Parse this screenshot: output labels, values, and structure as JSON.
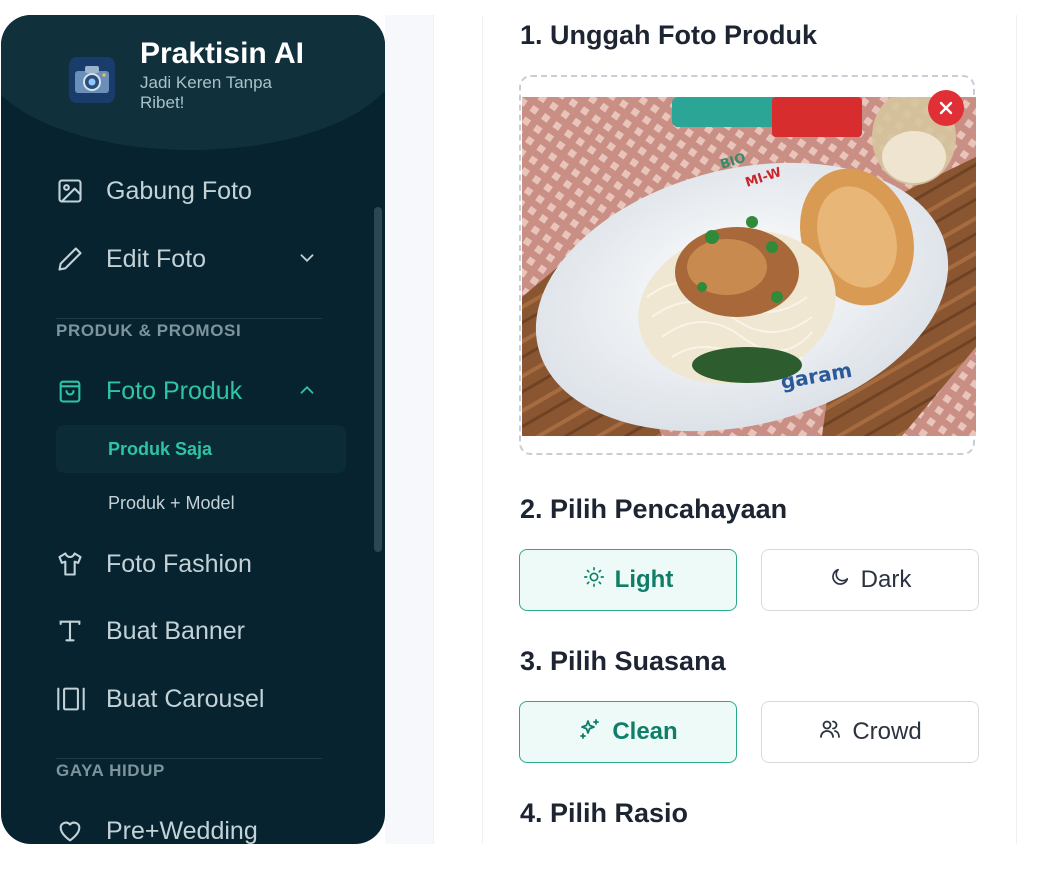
{
  "app": {
    "title": "Praktisin AI",
    "subtitle": "Jadi Keren Tanpa Ribet!"
  },
  "sidebar": {
    "items_top": [
      {
        "label": "Gabung Foto",
        "icon": "image-icon"
      },
      {
        "label": "Edit Foto",
        "icon": "pencil-icon",
        "chevron": "down"
      }
    ],
    "section_product": "PRODUK & PROMOSI",
    "foto_produk": {
      "label": "Foto Produk",
      "icon": "shopping-bag-icon",
      "chevron": "up"
    },
    "sub_items": [
      {
        "label": "Produk Saja",
        "active": true
      },
      {
        "label": "Produk + Model",
        "active": false
      }
    ],
    "items_mid": [
      {
        "label": "Foto Fashion",
        "icon": "shirt-icon"
      },
      {
        "label": "Buat Banner",
        "icon": "text-icon"
      },
      {
        "label": "Buat Carousel",
        "icon": "carousel-icon"
      }
    ],
    "section_life": "GAYA HIDUP",
    "items_bottom": [
      {
        "label": "Pre+Wedding",
        "icon": "heart-icon"
      }
    ]
  },
  "main": {
    "step1": "1. Unggah Foto Produk",
    "step2": "2. Pilih Pencahayaan",
    "lighting": [
      {
        "label": "Light",
        "icon": "sun-icon",
        "selected": true
      },
      {
        "label": "Dark",
        "icon": "moon-icon",
        "selected": false
      }
    ],
    "step3": "3. Pilih Suasana",
    "mood": [
      {
        "label": "Clean",
        "icon": "sparkles-icon",
        "selected": true
      },
      {
        "label": "Crowd",
        "icon": "users-icon",
        "selected": false
      }
    ],
    "step4": "4. Pilih Rasio"
  },
  "colors": {
    "sidebar_bg": "#06232f",
    "accent": "#2ec4a4",
    "remove": "#e02f35"
  }
}
